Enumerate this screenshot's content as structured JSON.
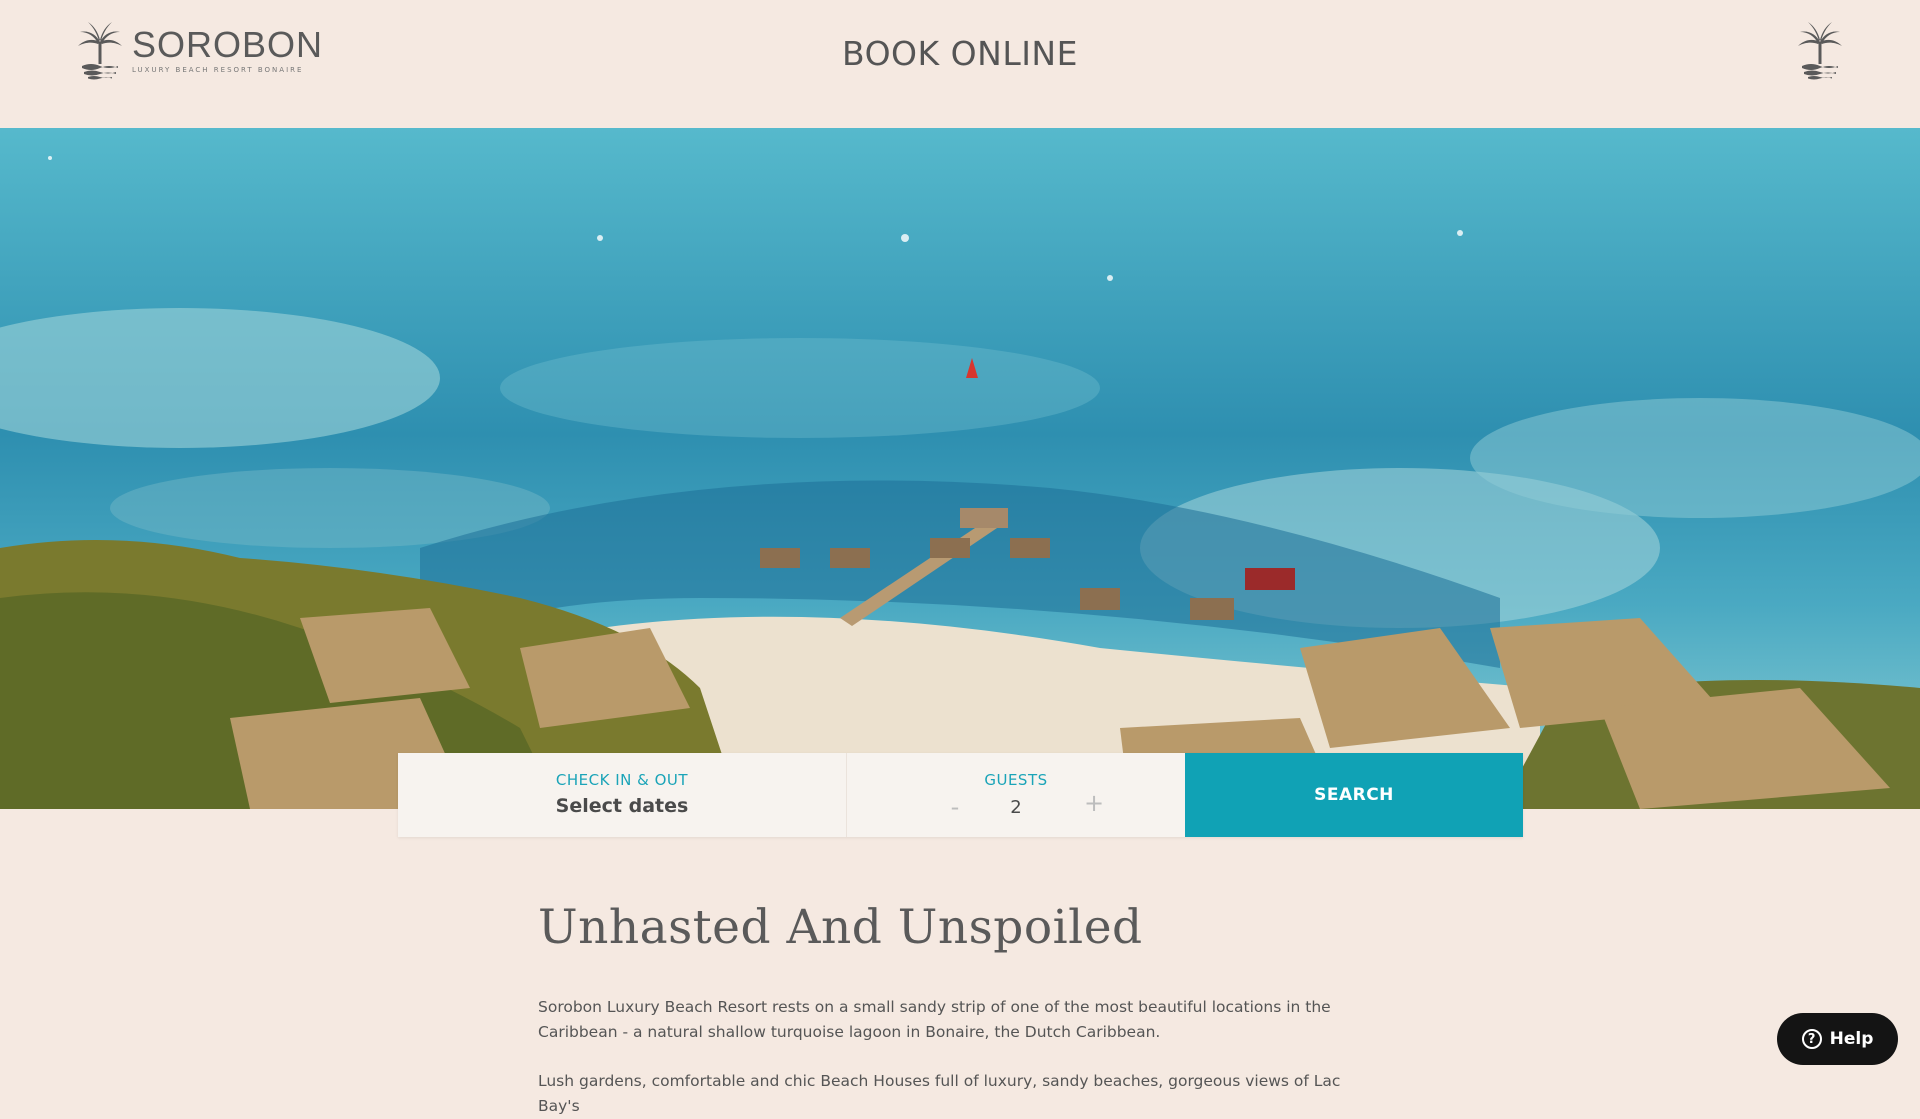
{
  "header": {
    "logo_name": "SOROBON",
    "logo_tagline": "LUXURY BEACH RESORT BONAIRE",
    "title": "BOOK ONLINE"
  },
  "booking": {
    "dates_label": "CHECK IN & OUT",
    "dates_value": "Select dates",
    "guests_label": "GUESTS",
    "guests_minus": "-",
    "guests_count": "2",
    "guests_plus": "+",
    "search_label": "SEARCH"
  },
  "content": {
    "heading": "Unhasted And Unspoiled",
    "paragraph1": "Sorobon Luxury Beach Resort rests on a small sandy strip of one of the most beautiful locations in the Caribbean - a natural shallow turquoise lagoon in Bonaire, the Dutch Caribbean.",
    "paragraph2": "Lush gardens, comfortable and chic Beach Houses full of luxury, sandy beaches, gorgeous views of Lac Bay's"
  },
  "help": {
    "label": "Help",
    "icon": "?"
  },
  "colors": {
    "background": "#f5e9e1",
    "accent": "#10a2b5",
    "label_accent": "#1ba4b8",
    "help_bg": "#141414"
  },
  "icons": {
    "logo": "palm-tree-icon",
    "menu": "palm-tree-icon"
  }
}
